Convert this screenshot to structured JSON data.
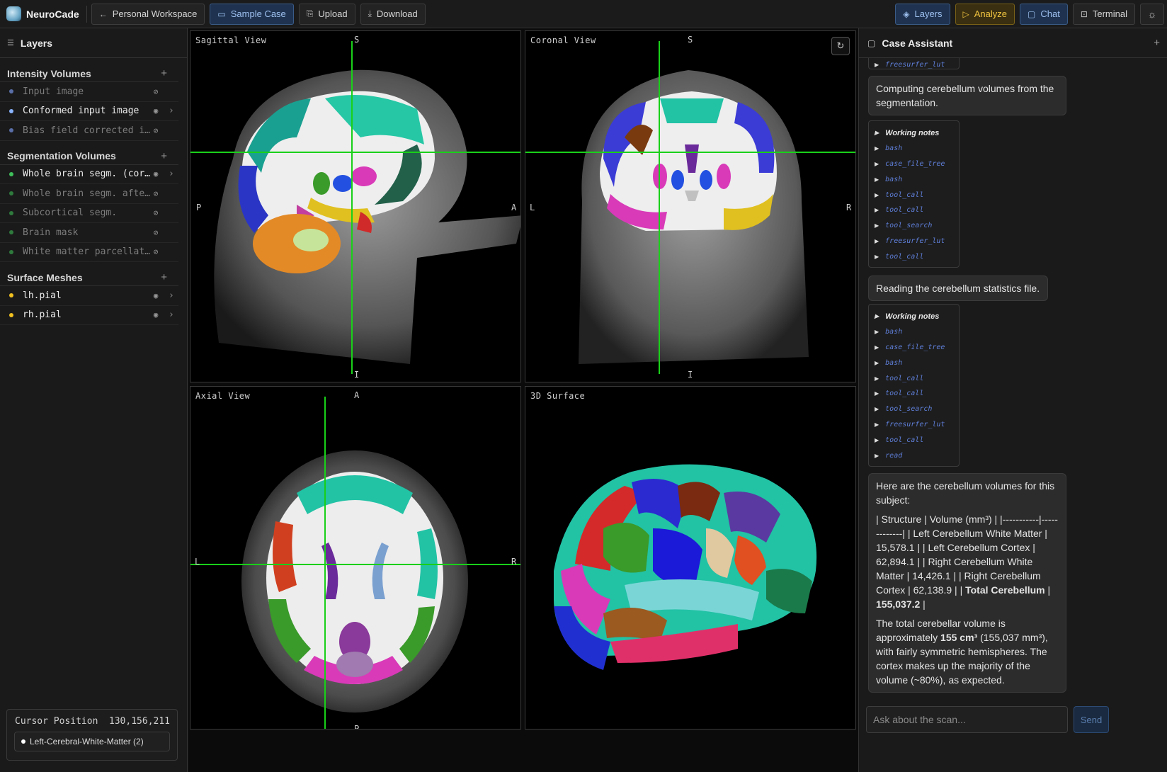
{
  "app": {
    "name": "NeuroCade"
  },
  "toolbar": {
    "workspace": "Personal Workspace",
    "sample_case": "Sample Case",
    "upload": "Upload",
    "download": "Download",
    "layers": "Layers",
    "analyze": "Analyze",
    "chat": "Chat",
    "terminal": "Terminal"
  },
  "sidebar": {
    "title": "Layers",
    "groups": [
      {
        "title": "Intensity Volumes",
        "items": [
          {
            "label": "Input image",
            "visible": false,
            "color": "#5a6fa8"
          },
          {
            "label": "Conformed input image",
            "visible": true,
            "color": "#8ab4ff"
          },
          {
            "label": "Bias field corrected i…",
            "visible": false,
            "color": "#5a6fa8"
          }
        ]
      },
      {
        "title": "Segmentation Volumes",
        "items": [
          {
            "label": "Whole brain segm. (cor…",
            "visible": true,
            "color": "#3fbf5a"
          },
          {
            "label": "Whole brain segm. afte…",
            "visible": false,
            "color": "#2f7a3d"
          },
          {
            "label": "Subcortical segm.",
            "visible": false,
            "color": "#2f7a3d"
          },
          {
            "label": "Brain mask",
            "visible": false,
            "color": "#2f7a3d"
          },
          {
            "label": "White matter parcellat…",
            "visible": false,
            "color": "#2f7a3d"
          }
        ]
      },
      {
        "title": "Surface Meshes",
        "items": [
          {
            "label": "lh.pial",
            "visible": true,
            "color": "#f0c020"
          },
          {
            "label": "rh.pial",
            "visible": true,
            "color": "#f0c020"
          }
        ]
      }
    ],
    "cursor": {
      "label": "Cursor Position",
      "coords": "130,156,211",
      "region": "Left-Cerebral-White-Matter (2)"
    }
  },
  "views": {
    "sagittal": {
      "label": "Sagittal View",
      "top": "S",
      "bottom": "I",
      "left": "P",
      "right": "A"
    },
    "coronal": {
      "label": "Coronal View",
      "top": "S",
      "bottom": "I",
      "left": "L",
      "right": "R"
    },
    "axial": {
      "label": "Axial View",
      "top": "A",
      "bottom": "P",
      "left": "L",
      "right": "R"
    },
    "surface": {
      "label": "3D Surface"
    }
  },
  "chat": {
    "title": "Case Assistant",
    "top_partial": "freesurfer_lut",
    "msg1": "Computing cerebellum volumes from the segmentation.",
    "notes_title": "Working notes",
    "notes1": [
      "bash",
      "case_file_tree",
      "bash",
      "tool_call",
      "tool_call",
      "tool_search",
      "freesurfer_lut",
      "tool_call"
    ],
    "msg2": "Reading the cerebellum statistics file.",
    "notes2": [
      "bash",
      "case_file_tree",
      "bash",
      "tool_call",
      "tool_call",
      "tool_search",
      "freesurfer_lut",
      "tool_call",
      "read"
    ],
    "answer_intro": "Here are the cerebellum volumes for this subject:",
    "table_text_a": "| Structure | Volume (mm³) | |-----------|-------------| | Left Cerebellum White Matter | 15,578.1 | | Left Cerebellum Cortex | 62,894.1 | | Right Cerebellum White Matter | 14,426.1 | | Right Cerebellum Cortex | 62,138.9 | | ",
    "table_total_label": "Total Cerebellum",
    "table_mid": " | ",
    "table_total_value": "155,037.2",
    "table_end": " |",
    "summary_a": "The total cerebellar volume is approximately ",
    "summary_bold": "155 cm³",
    "summary_b": " (155,037 mm³), with fairly symmetric hemispheres. The cortex makes up the majority of the volume (~80%), as expected.",
    "placeholder": "Ask about the scan...",
    "send": "Send"
  }
}
